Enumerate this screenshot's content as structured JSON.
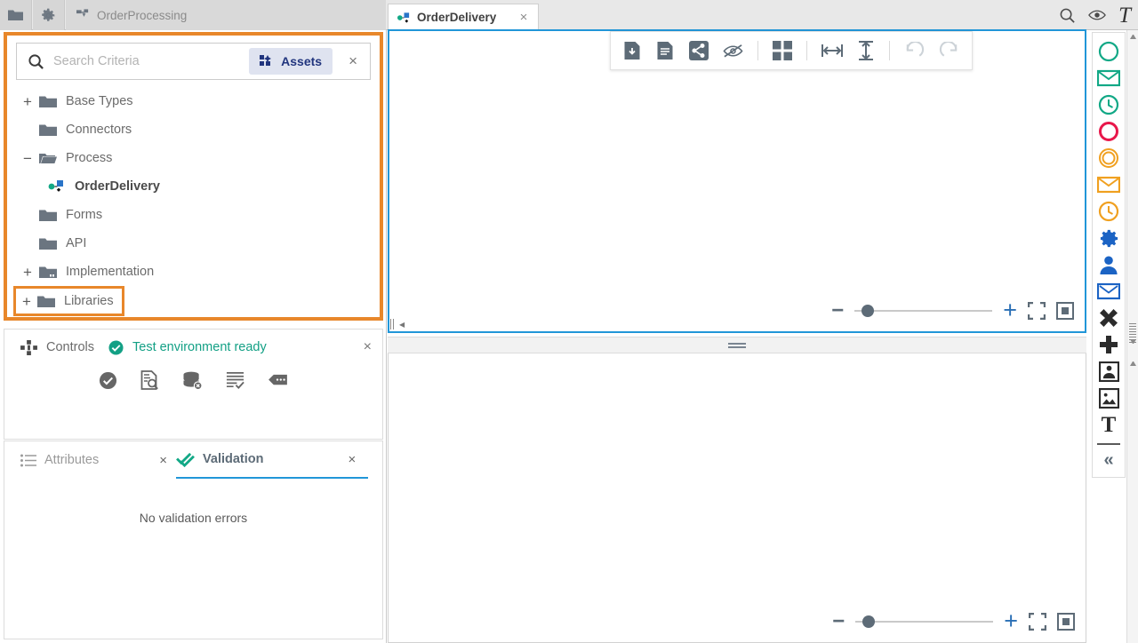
{
  "window": {
    "top_toolbar": [
      {
        "name": "folder-icon",
        "label": "Folder"
      },
      {
        "name": "gear-icon",
        "label": "Settings"
      }
    ],
    "project_tab": {
      "label": "OrderProcessing",
      "icon": "process-icon"
    },
    "document_tab": {
      "label": "OrderDelivery",
      "icon": "process-icon",
      "close": "×"
    },
    "top_right_icons": [
      {
        "name": "search-icon",
        "glyph": "search"
      },
      {
        "name": "eye-icon",
        "glyph": "eye"
      },
      {
        "name": "text-format-icon",
        "glyph": "T"
      }
    ]
  },
  "explorer": {
    "search": {
      "placeholder": "Search Criteria",
      "value": ""
    },
    "assets_button": {
      "label": "Assets"
    },
    "close_label": "×",
    "tree": [
      {
        "label": "Base Types",
        "expander": "+",
        "icon": "folder-icon",
        "indent": 0,
        "bold": false,
        "highlight": false
      },
      {
        "label": "Connectors",
        "expander": "",
        "icon": "folder-icon",
        "indent": 0,
        "bold": false,
        "highlight": false
      },
      {
        "label": "Process",
        "expander": "−",
        "icon": "folder-open-icon",
        "indent": 0,
        "bold": false,
        "highlight": false
      },
      {
        "label": "OrderDelivery",
        "expander": "",
        "icon": "process-icon",
        "indent": 1,
        "bold": true,
        "highlight": false
      },
      {
        "label": "Forms",
        "expander": "",
        "icon": "folder-icon",
        "indent": 0,
        "bold": false,
        "highlight": false
      },
      {
        "label": "API",
        "expander": "",
        "icon": "folder-icon",
        "indent": 0,
        "bold": false,
        "highlight": false
      },
      {
        "label": "Implementation",
        "expander": "+",
        "icon": "folder-impl-icon",
        "indent": 0,
        "bold": false,
        "highlight": false
      },
      {
        "label": "Libraries",
        "expander": "+",
        "icon": "folder-icon",
        "indent": 0,
        "bold": false,
        "highlight": true
      }
    ]
  },
  "controls_panel": {
    "title": "Controls",
    "status": "Test environment ready",
    "close_label": "×",
    "buttons": [
      {
        "name": "run-test-button",
        "icon": "check-circle-icon"
      },
      {
        "name": "document-search-button",
        "icon": "document-search-icon"
      },
      {
        "name": "database-reset-button",
        "icon": "database-delete-icon"
      },
      {
        "name": "log-check-button",
        "icon": "list-check-icon"
      },
      {
        "name": "comment-button",
        "icon": "comment-icon"
      }
    ]
  },
  "validation_panel": {
    "tabs": [
      {
        "label": "Attributes",
        "icon": "list-icon",
        "active": false,
        "close": "×"
      },
      {
        "label": "Validation",
        "icon": "double-check-icon",
        "active": true,
        "close": "×"
      }
    ],
    "message": "No validation errors"
  },
  "editor": {
    "toolbar": [
      {
        "name": "save-file-button",
        "icon": "file-download-icon"
      },
      {
        "name": "document-button",
        "icon": "document-icon"
      },
      {
        "name": "share-button",
        "icon": "share-icon"
      },
      {
        "name": "hide-button",
        "icon": "eye-off-icon"
      },
      {
        "name": "grid-button",
        "icon": "grid-icon"
      },
      {
        "name": "fit-width-button",
        "icon": "fit-horizontal-icon"
      },
      {
        "name": "fit-height-button",
        "icon": "fit-vertical-icon"
      },
      {
        "name": "undo-button",
        "icon": "undo-icon",
        "disabled": true
      },
      {
        "name": "redo-button",
        "icon": "redo-icon",
        "disabled": true
      }
    ],
    "zoom_controls": {
      "minus": "−",
      "plus": "+",
      "fit_screen": "fit-screen-icon",
      "center": "center-icon",
      "value": 10
    }
  },
  "palette": {
    "items": [
      {
        "name": "start-event-none",
        "icon": "circle",
        "color": "#12a886"
      },
      {
        "name": "start-event-message",
        "icon": "envelope",
        "color": "#12a886"
      },
      {
        "name": "start-event-timer",
        "icon": "clock",
        "color": "#12a886"
      },
      {
        "name": "end-event-none",
        "icon": "circle",
        "color": "#e8174a"
      },
      {
        "name": "intermediate-event",
        "icon": "double-circle",
        "color": "#f0a020"
      },
      {
        "name": "intermediate-message",
        "icon": "envelope",
        "color": "#f0a020"
      },
      {
        "name": "intermediate-timer",
        "icon": "clock",
        "color": "#f0a020"
      },
      {
        "name": "service-task",
        "icon": "gear",
        "color": "#1b63c4"
      },
      {
        "name": "user-task",
        "icon": "person",
        "color": "#1b63c4"
      },
      {
        "name": "send-task",
        "icon": "envelope-box",
        "color": "#1b63c4"
      },
      {
        "name": "exclusive-gateway",
        "icon": "x-gateway",
        "color": "#2b2b2b"
      },
      {
        "name": "parallel-gateway",
        "icon": "plus-gateway",
        "color": "#2b2b2b"
      },
      {
        "name": "pool-lane",
        "icon": "pool",
        "color": "#2b2b2b"
      },
      {
        "name": "image-artifact",
        "icon": "image",
        "color": "#2b2b2b"
      },
      {
        "name": "text-annotation",
        "icon": "text-T",
        "color": "#2b2b2b"
      }
    ],
    "collapse_label": "«"
  },
  "colors": {
    "highlight_orange": "#e8872a",
    "selection_blue": "#2196d8",
    "assets_blue": "#21357e",
    "status_green": "#13a085"
  }
}
